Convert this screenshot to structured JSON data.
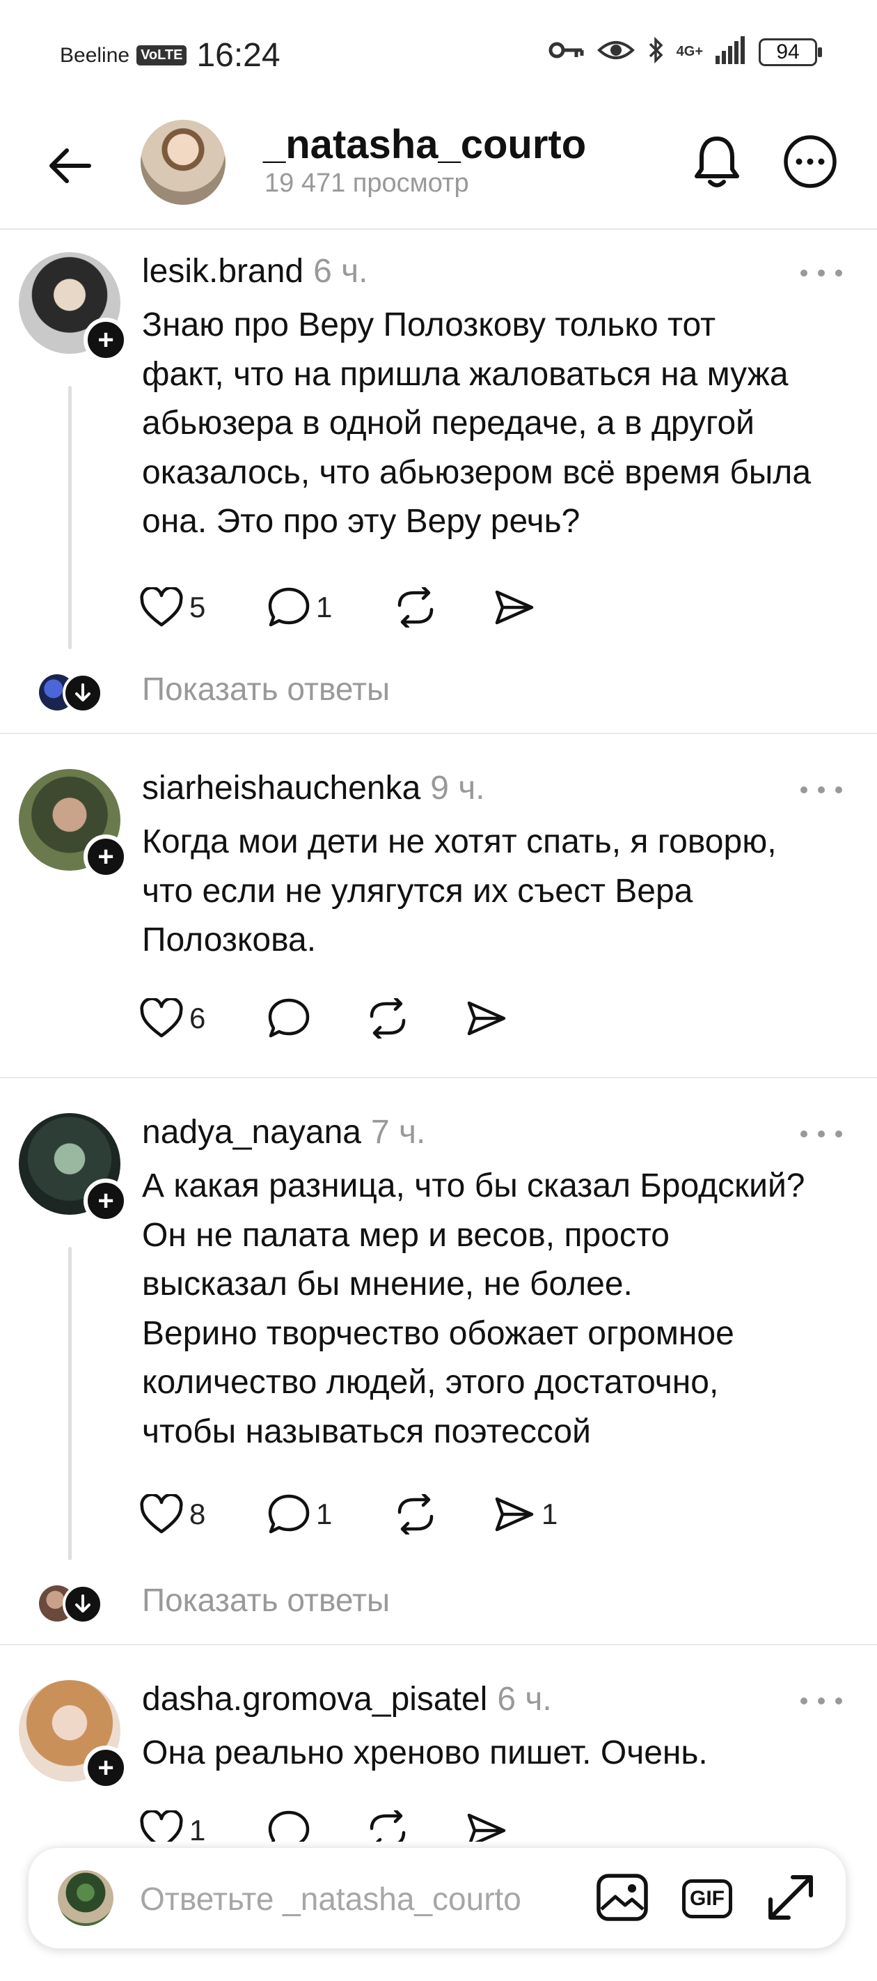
{
  "status_bar": {
    "carrier": "Beeline",
    "volte": "VoLTE",
    "time": "16:24",
    "network": "4G+",
    "battery": "94"
  },
  "header": {
    "title": "_natasha_courto",
    "subtitle": "19 471 просмотр",
    "icons": [
      "back-arrow-icon",
      "bell-icon",
      "more-icon"
    ]
  },
  "comments": [
    {
      "username": "lesik.brand",
      "time": "6 ч.",
      "text": "Знаю про Веру Полозкову только тот\nфакт, что на пришла жаловаться на мужа\nабьюзера в одной передаче, а в другой\nоказалось, что абьюзером всё время была\nона. Это про эту Веру речь?",
      "likes": "5",
      "replies": "1",
      "shares": "",
      "show_replies": "Показать ответы"
    },
    {
      "username": "siarheishauchenka",
      "time": "9 ч.",
      "text": "Когда мои дети не хотят спать, я говорю,\nчто если не улягутся их съест Вера\nПолозкова.",
      "likes": "6",
      "replies": "",
      "shares": ""
    },
    {
      "username": "nadya_nayana",
      "time": "7 ч.",
      "text": "А какая разница, что бы сказал Бродский?\nОн не палата мер и весов, просто\nвысказал бы мнение, не более.\nВерино творчество обожает огромное\nколичество людей, этого достаточно,\nчтобы называться поэтессой",
      "likes": "8",
      "replies": "1",
      "shares": "1",
      "show_replies": "Показать ответы"
    },
    {
      "username": "dasha.gromova_pisatel",
      "time": "6 ч.",
      "text": "Она реально хреново пишет. Очень.",
      "likes": "1",
      "replies": "",
      "shares": ""
    }
  ],
  "reply_bar": {
    "placeholder": "Ответьте _natasha_courto",
    "gif_label": "GIF"
  },
  "colors": {
    "text": "#111111",
    "muted": "#999999",
    "divider": "#e9e9e9"
  }
}
